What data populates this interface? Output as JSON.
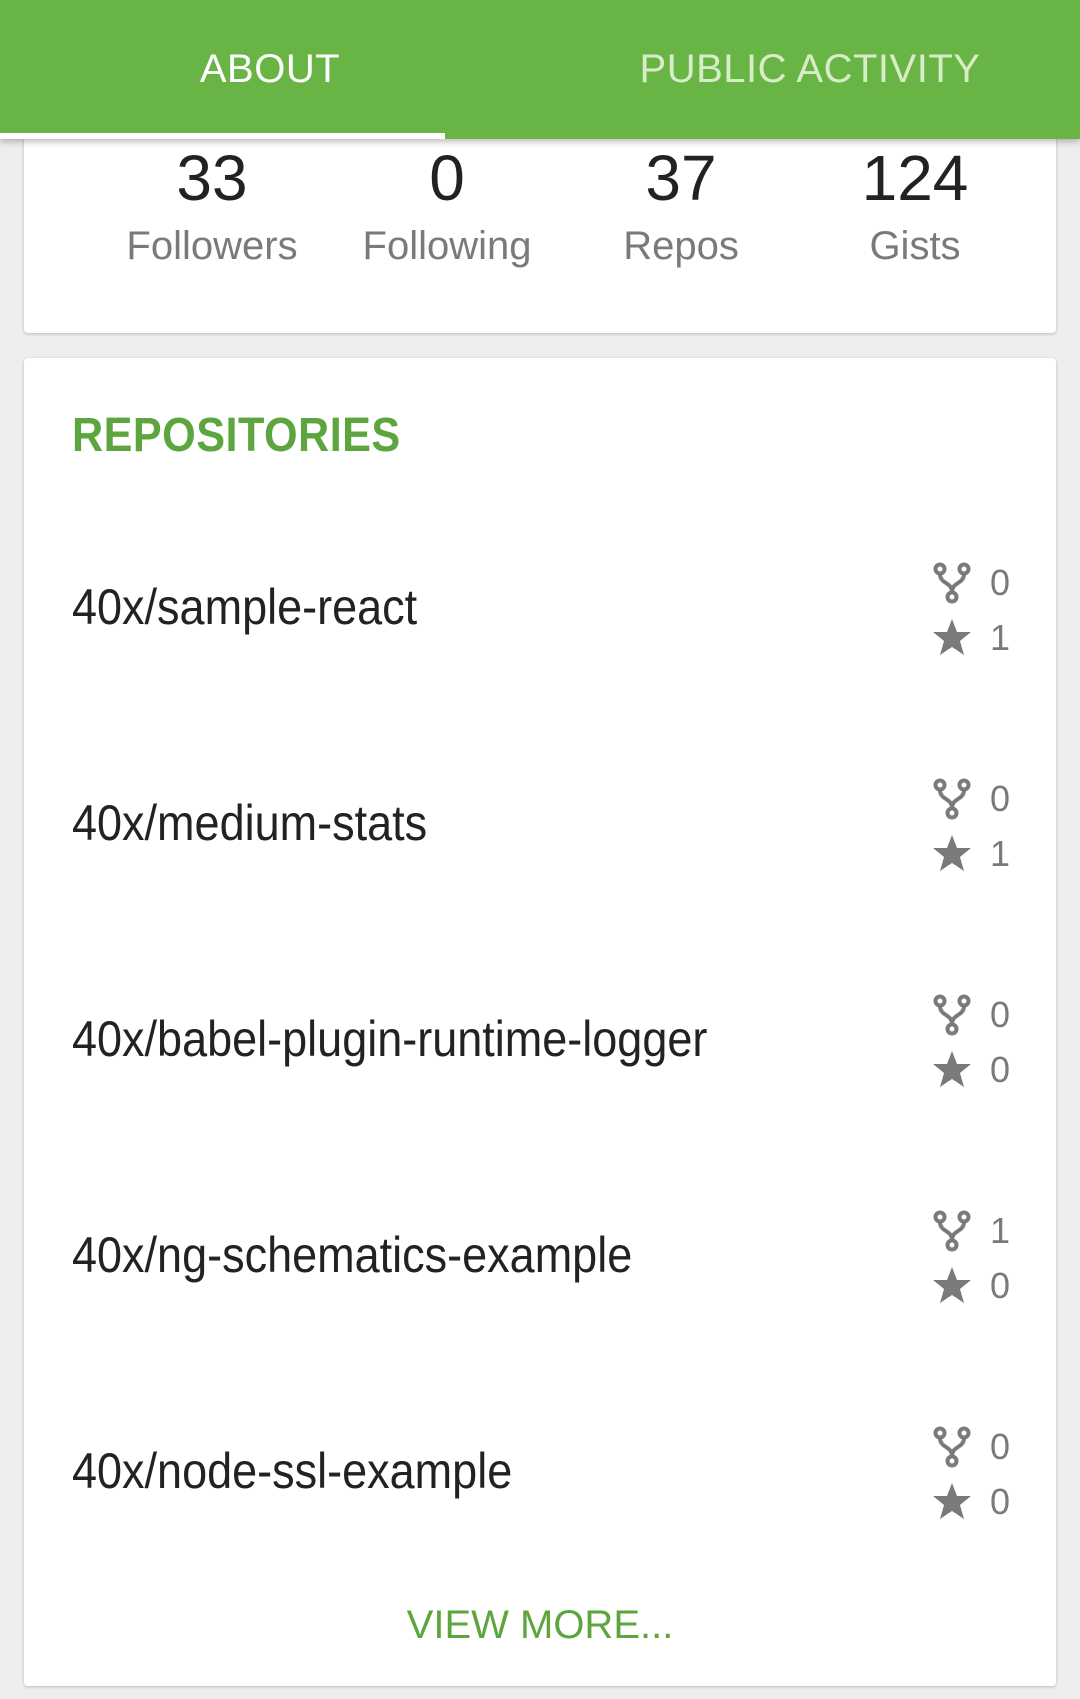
{
  "tabs": [
    {
      "label": "ABOUT",
      "active": true
    },
    {
      "label": "PUBLIC ACTIVITY",
      "active": false
    }
  ],
  "stats": [
    {
      "value": "33",
      "label": "Followers"
    },
    {
      "value": "0",
      "label": "Following"
    },
    {
      "value": "37",
      "label": "Repos"
    },
    {
      "value": "124",
      "label": "Gists"
    }
  ],
  "repositories": {
    "title": "REPOSITORIES",
    "items": [
      {
        "name": "40x/sample-react",
        "forks": "0",
        "stars": "1"
      },
      {
        "name": "40x/medium-stats",
        "forks": "0",
        "stars": "1"
      },
      {
        "name": "40x/babel-plugin-runtime-logger",
        "forks": "0",
        "stars": "0"
      },
      {
        "name": "40x/ng-schematics-example",
        "forks": "1",
        "stars": "0"
      },
      {
        "name": "40x/node-ssl-example",
        "forks": "0",
        "stars": "0"
      }
    ],
    "view_more": "VIEW MORE..."
  },
  "colors": {
    "accent": "#68b545",
    "accent_text": "#5da63f",
    "muted_text": "#7a7a7a",
    "icon": "#7a7a7a"
  },
  "icons": {
    "fork": "fork-icon",
    "star": "star-icon"
  }
}
